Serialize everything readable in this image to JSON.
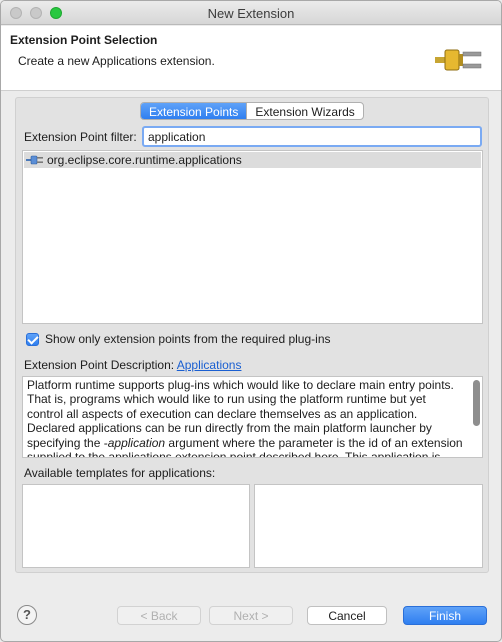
{
  "window": {
    "title": "New Extension"
  },
  "header": {
    "title": "Extension Point Selection",
    "subtitle": "Create a new Applications extension.",
    "icon": "plug-icon"
  },
  "tabs": [
    {
      "label": "Extension Points",
      "active": true
    },
    {
      "label": "Extension Wizards",
      "active": false
    }
  ],
  "filter": {
    "label": "Extension Point filter:",
    "value": "application"
  },
  "extension_points": [
    {
      "label": "org.eclipse.core.runtime.applications",
      "icon": "plug-icon",
      "selected": true
    }
  ],
  "only_required_checkbox": {
    "label": "Show only extension points from the required plug-ins",
    "checked": true
  },
  "description": {
    "label": "Extension Point Description:",
    "link": "Applications",
    "text_part1": "Platform runtime supports plug-ins which would like to declare main entry points. That is, programs which would like to run using the platform runtime but yet control all aspects of execution can declare themselves as an application. Declared applications can be run directly from the main platform launcher by specifying the -",
    "text_em": "application",
    "text_part2": " argument where the parameter is the id of an extension supplied to the applications extension point described here. This application is instantiated and"
  },
  "templates": {
    "label": "Available templates for applications:"
  },
  "footer": {
    "help": "?",
    "back": "< Back",
    "next": "Next >",
    "cancel": "Cancel",
    "finish": "Finish"
  },
  "colors": {
    "accent": "#2f7ff0",
    "link": "#1a5fd1",
    "zoom_button": "#28c840"
  }
}
